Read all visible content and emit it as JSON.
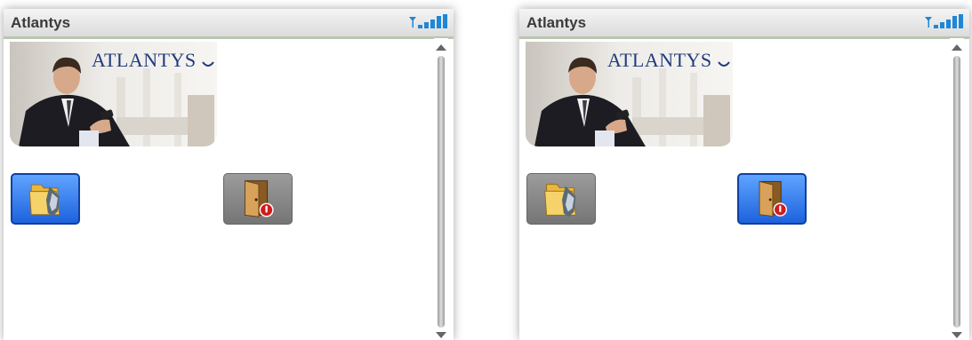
{
  "screens": [
    {
      "title": "Atlantys",
      "brand": "ATLANTYS",
      "icons": [
        {
          "name": "folder-icon",
          "selected": true
        },
        {
          "name": "exit-door-icon",
          "selected": false
        }
      ]
    },
    {
      "title": "Atlantys",
      "brand": "ATLANTYS",
      "icons": [
        {
          "name": "folder-icon",
          "selected": false
        },
        {
          "name": "exit-door-icon",
          "selected": true
        }
      ]
    }
  ],
  "colors": {
    "selected_accent": "#2a6ee8",
    "brand_text": "#203b7c"
  }
}
